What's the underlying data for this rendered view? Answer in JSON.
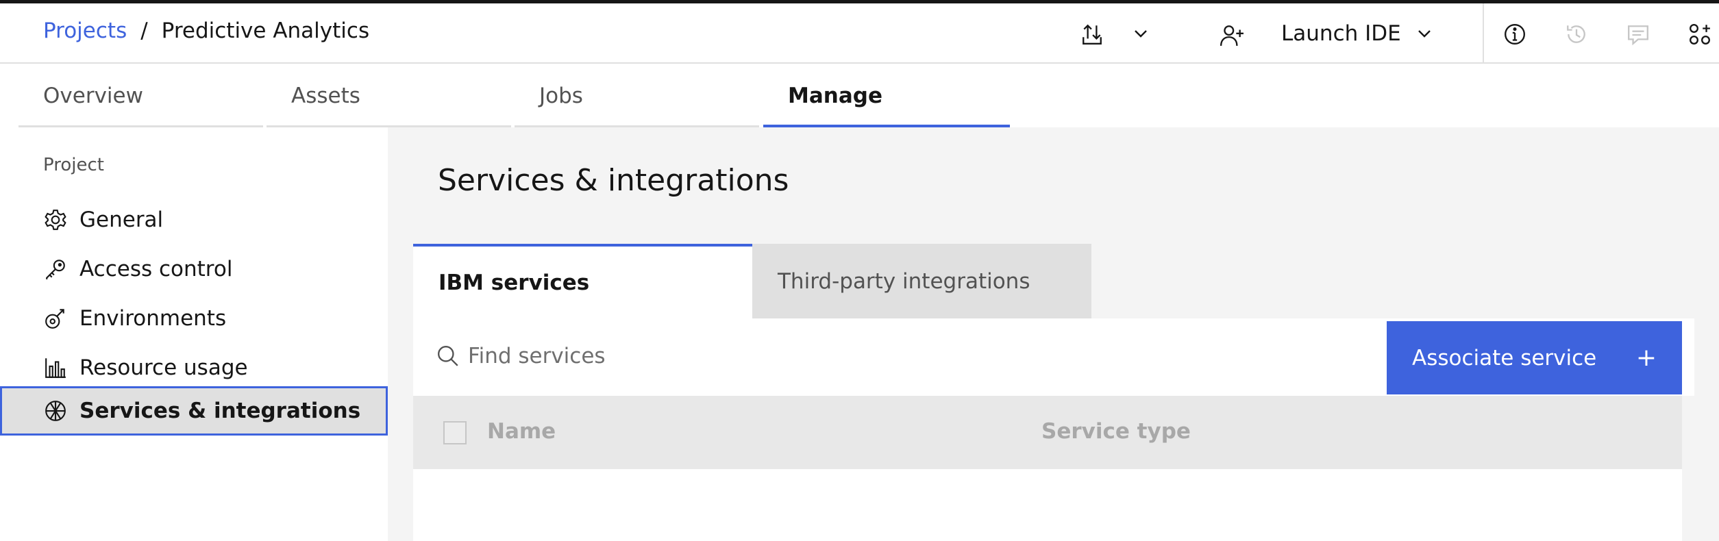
{
  "colors": {
    "accent": "#3e63dd",
    "text_primary": "#161616",
    "text_secondary": "#525252",
    "main_bg": "#f4f4f4",
    "tab_inactive_bg": "#e0e0e0",
    "button_bg": "#3e63dd"
  },
  "header": {
    "breadcrumb": {
      "link": "Projects",
      "separator": "/",
      "current": "Predictive Analytics"
    },
    "icons": [
      "transfer-icon",
      "chevron-down-icon",
      "add-user-icon",
      "info-icon",
      "history-icon",
      "comment-icon",
      "apps-icon"
    ],
    "launch_ide": "Launch IDE"
  },
  "tabs": [
    {
      "label": "Overview",
      "active": false
    },
    {
      "label": "Assets",
      "active": false
    },
    {
      "label": "Jobs",
      "active": false
    },
    {
      "label": "Manage",
      "active": true
    }
  ],
  "sidebar": {
    "section": "Project",
    "items": [
      {
        "label": "General",
        "icon": "gear-icon",
        "active": false
      },
      {
        "label": "Access control",
        "icon": "key-icon",
        "active": false
      },
      {
        "label": "Environments",
        "icon": "environment-icon",
        "active": false
      },
      {
        "label": "Resource usage",
        "icon": "bar-chart-icon",
        "active": false
      },
      {
        "label": "Services & integrations",
        "icon": "integrations-icon",
        "active": true
      }
    ]
  },
  "main": {
    "title": "Services & integrations",
    "content_tabs": [
      {
        "label": "IBM services",
        "active": true
      },
      {
        "label": "Third-party integrations",
        "active": false
      }
    ],
    "search": {
      "placeholder": "Find services",
      "value": ""
    },
    "associate_button": "Associate service",
    "table": {
      "columns": [
        "Name",
        "Service type"
      ],
      "rows": []
    }
  }
}
